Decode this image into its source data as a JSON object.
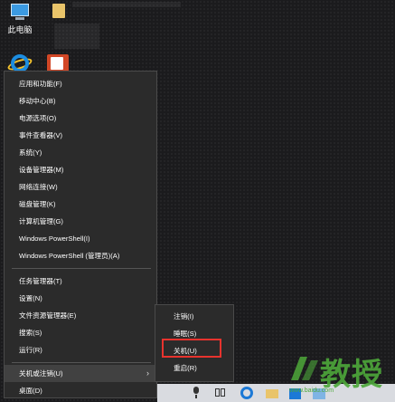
{
  "desktop": {
    "this_pc_label": "此电脑"
  },
  "context_menu": {
    "group1": [
      "应用和功能(F)",
      "移动中心(B)",
      "电源选项(O)",
      "事件查看器(V)",
      "系统(Y)",
      "设备管理器(M)",
      "网络连接(W)",
      "磁盘管理(K)",
      "计算机管理(G)",
      "Windows PowerShell(I)",
      "Windows PowerShell (管理员)(A)"
    ],
    "group2": [
      "任务管理器(T)",
      "设置(N)",
      "文件资源管理器(E)",
      "搜索(S)",
      "运行(R)"
    ],
    "shutdown_label": "关机或注销(U)",
    "desktop_label": "桌面(D)",
    "submenu_arrow": "›"
  },
  "submenu": {
    "items": [
      "注销(I)",
      "睡眠(S)",
      "关机(U)",
      "重启(R)"
    ],
    "highlight_color": "#e8332e"
  },
  "taskbar": {
    "icons": [
      "microphone-icon",
      "task-view-icon",
      "edge-icon",
      "file-explorer-icon",
      "store-icon",
      "app-icon"
    ]
  },
  "watermark": {
    "word": "教授",
    "url": "www.baidu.com"
  }
}
